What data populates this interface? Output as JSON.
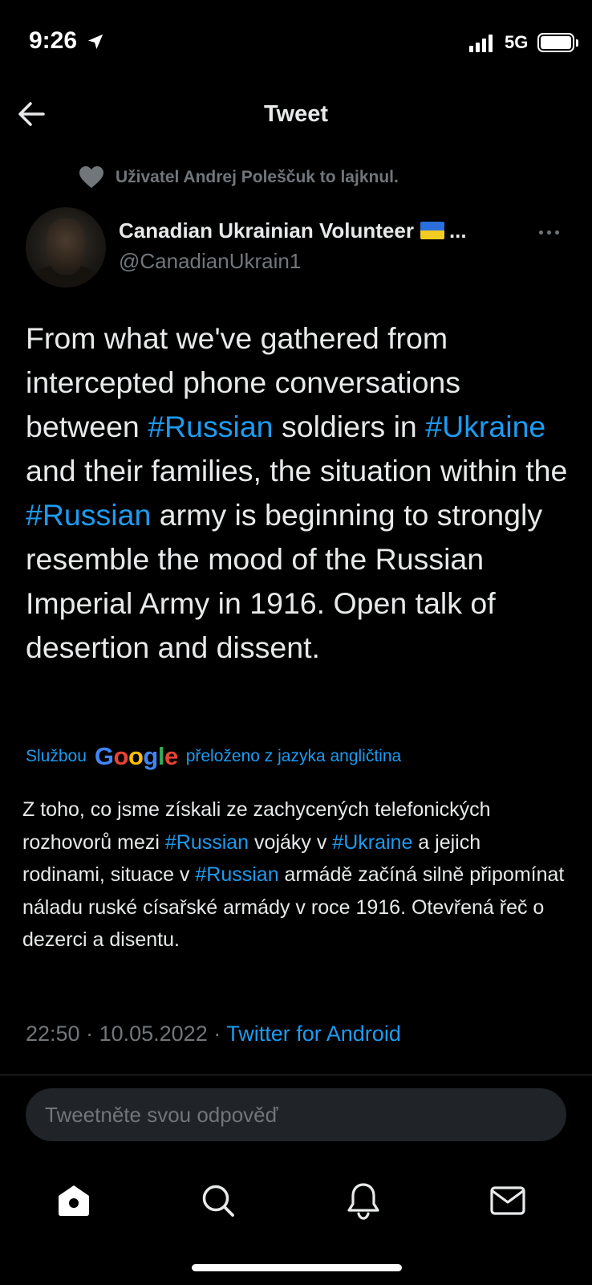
{
  "status_bar": {
    "time": "9:26",
    "network": "5G",
    "icons": [
      "location-arrow-icon",
      "signal-icon",
      "battery-icon"
    ]
  },
  "header": {
    "title": "Tweet",
    "back_icon": "arrow-left-icon"
  },
  "social_context": {
    "icon": "heart-icon",
    "text": "Uživatel Andrej Polеščuk to lajknul."
  },
  "author": {
    "name": "Canadian Ukrainian Volunteer",
    "name_suffix": "...",
    "handle": "@CanadianUkrain1",
    "flag_colors": [
      "#2a6fdb",
      "#f2cc22"
    ]
  },
  "tweet": {
    "p1": "From what we've gathered from intercepted phone conversations between ",
    "tag1": "#Russian",
    "p2": " soldiers in ",
    "tag2": "#Ukraine",
    "p3": " and their families, the situation within the ",
    "tag3": "#Russian",
    "p4": " army is beginning to strongly resemble the mood of the Russian Imperial Army in 1916. Open talk of desertion and dissent."
  },
  "translation_label": {
    "prefix": "Službou",
    "google": [
      "G",
      "o",
      "o",
      "g",
      "l",
      "e"
    ],
    "suffix": "přeloženo z jazyka angličtina"
  },
  "translation": {
    "p1": "Z toho, co jsme získali ze zachycených telefonických rozhovorů mezi ",
    "tag1": "#Russian",
    "p2": " vojáky v ",
    "tag2": "#Ukraine",
    "p3": " a jejich rodinami, situace v ",
    "tag3": "#Russian",
    "p4": " armádě začíná silně připomínat náladu ruské císařské armády v roce 1916. Otevřená řeč o dezerci a disentu."
  },
  "meta": {
    "time": "22:50",
    "separator": " · ",
    "date": "10.05.2022",
    "source": "Twitter for Android"
  },
  "reply": {
    "placeholder": "Tweetněte svou odpověď"
  },
  "bottom_nav": {
    "items": [
      "home-icon",
      "search-icon",
      "notifications-bell-icon",
      "messages-envelope-icon"
    ]
  },
  "colors": {
    "background": "#000000",
    "text": "#e7e9ea",
    "secondary": "#71767b",
    "link": "#1d9bf0"
  }
}
